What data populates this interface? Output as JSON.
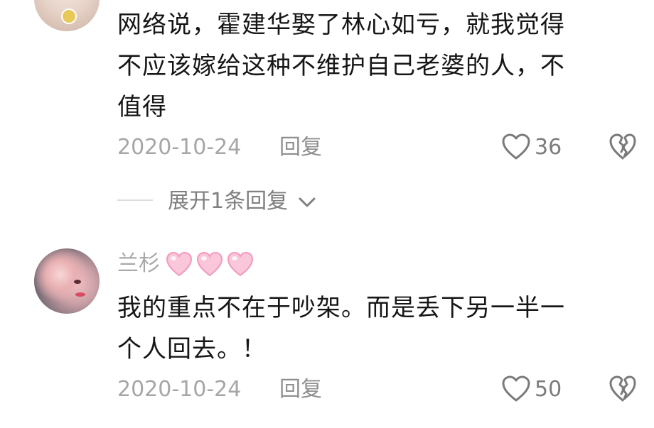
{
  "comments": [
    {
      "text_line1": "网络说，霍建华娶了林心如亏，就我觉得",
      "text_line2": "不应该嫁给这种不维护自己老婆的人，不",
      "text_line3": "值得",
      "date": "2020-10-24",
      "reply_label": "回复",
      "like_count": "36",
      "expand_replies_label": "展开1条回复"
    },
    {
      "username": "兰杉",
      "text_line1": "我的重点不在于吵架。而是丢下另一半一",
      "text_line2": "个人回去。！",
      "date": "2020-10-24",
      "reply_label": "回复",
      "like_count": "50"
    }
  ],
  "icons": {
    "like": "heart-outline-icon",
    "dislike": "broken-heart-icon",
    "expand": "chevron-down-icon",
    "username_decoration": "pink-heart-icon"
  },
  "colors": {
    "text": "#161616",
    "meta": "#a6a6a6",
    "icon": "#7a7a7a",
    "pink_heart": "#f6a9c6"
  }
}
